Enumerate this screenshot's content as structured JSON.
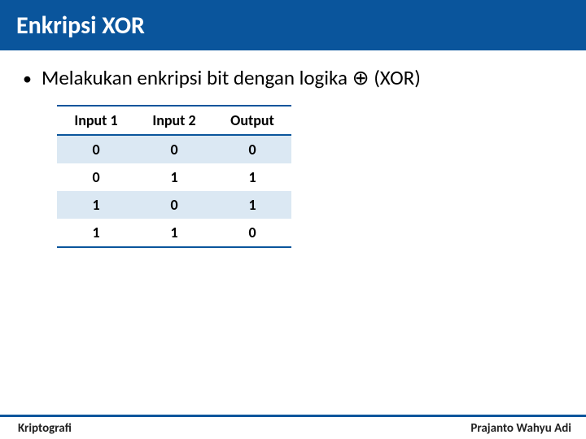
{
  "title": "Enkripsi XOR",
  "bullet_text_prefix": "Melakukan enkripsi bit dengan logika ",
  "bullet_symbol": "⊕",
  "bullet_text_suffix": " (XOR)",
  "chart_data": {
    "type": "table",
    "title": "XOR truth table",
    "headers": [
      "Input 1",
      "Input 2",
      "Output"
    ],
    "rows": [
      [
        "0",
        "0",
        "0"
      ],
      [
        "0",
        "1",
        "1"
      ],
      [
        "1",
        "0",
        "1"
      ],
      [
        "1",
        "1",
        "0"
      ]
    ]
  },
  "footer": {
    "left": "Kriptografi",
    "right": "Prajanto Wahyu Adi"
  }
}
